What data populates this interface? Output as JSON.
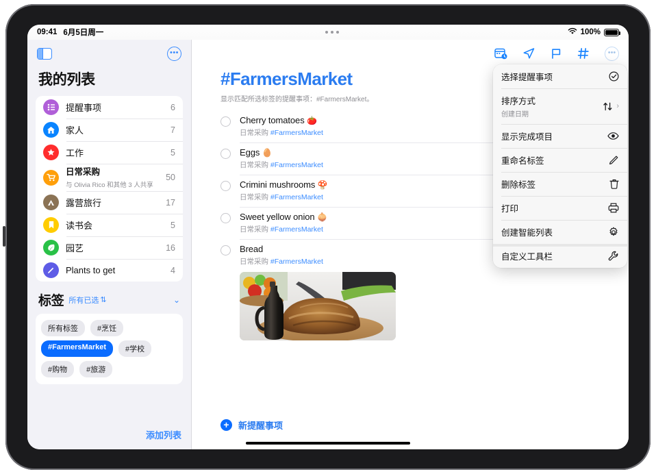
{
  "status_bar": {
    "time": "09:41",
    "date": "6月5日周一",
    "wifi_icon": "wifi-icon",
    "battery_percent": "100%",
    "battery_icon": "battery-full-icon"
  },
  "multitask_indicator": "multitasking-dots",
  "sidebar": {
    "toggle_icon": "sidebar-toggle-icon",
    "more_icon": "ellipsis-circle-icon",
    "title": "我的列表",
    "lists": [
      {
        "name": "提醒事项",
        "count": "6",
        "icon": "list-bullet-icon",
        "color": "#b05fd8",
        "subtitle": ""
      },
      {
        "name": "家人",
        "count": "7",
        "icon": "house-icon",
        "color": "#0a84ff",
        "subtitle": ""
      },
      {
        "name": "工作",
        "count": "5",
        "icon": "star-icon",
        "color": "#ff2d2d",
        "subtitle": ""
      },
      {
        "name": "日常采购",
        "count": "50",
        "icon": "shopping-cart-icon",
        "color": "#ff9f0a",
        "subtitle": "与 Olivia Rico 和其他 3 人共享"
      },
      {
        "name": "露营旅行",
        "count": "17",
        "icon": "tent-icon",
        "color": "#8b7355",
        "subtitle": ""
      },
      {
        "name": "读书会",
        "count": "5",
        "icon": "bookmark-icon",
        "color": "#ffcc00",
        "subtitle": ""
      },
      {
        "name": "园艺",
        "count": "16",
        "icon": "leaf-icon",
        "color": "#29c147",
        "subtitle": ""
      },
      {
        "name": "Plants to get",
        "count": "4",
        "icon": "pencil-icon",
        "color": "#5e5ce6",
        "subtitle": ""
      }
    ],
    "tags_section": {
      "title": "标签",
      "filter_label": "所有已选",
      "filter_icon": "up-down-chevron-icon",
      "collapse_icon": "chevron-down-icon",
      "tags": [
        {
          "label": "所有标签",
          "selected": false
        },
        {
          "label": "#烹饪",
          "selected": false
        },
        {
          "label": "#FarmersMarket",
          "selected": true
        },
        {
          "label": "#学校",
          "selected": false
        },
        {
          "label": "#购物",
          "selected": false
        },
        {
          "label": "#旅游",
          "selected": false
        }
      ]
    },
    "add_list_label": "添加列表"
  },
  "main": {
    "toolbar_icons": [
      "calendar-clock-icon",
      "location-arrow-icon",
      "flag-icon",
      "hashtag-icon"
    ],
    "more_icon": "ellipsis-circle-icon",
    "title": "#FarmersMarket",
    "subtitle": "显示匹配所选标签的提醒事项：#FarmersMarket。",
    "accent_color": "#2b7cf0",
    "reminders": [
      {
        "title": "Cherry tomatoes",
        "emoji": "🍅",
        "list": "日常采购",
        "tag": "#FarmersMarket",
        "completed": false,
        "has_photo": false
      },
      {
        "title": "Eggs",
        "emoji": "🥚",
        "list": "日常采购",
        "tag": "#FarmersMarket",
        "completed": false,
        "has_photo": false
      },
      {
        "title": "Crimini mushrooms",
        "emoji": "🍄",
        "list": "日常采购",
        "tag": "#FarmersMarket",
        "completed": false,
        "has_photo": false
      },
      {
        "title": "Sweet yellow onion",
        "emoji": "🧅",
        "list": "日常采购",
        "tag": "#FarmersMarket",
        "completed": false,
        "has_photo": false
      },
      {
        "title": "Bread",
        "emoji": "",
        "list": "日常采购",
        "tag": "#FarmersMarket",
        "completed": false,
        "has_photo": true
      }
    ],
    "photo_description": "bread-loaf-photo",
    "new_reminder": {
      "icon": "plus-circle-icon",
      "label": "新提醒事项"
    }
  },
  "context_menu": {
    "items": [
      {
        "label": "选择提醒事项",
        "sub": "",
        "icon": "checkmark-circle-icon",
        "chevron": false,
        "group_start": false
      },
      {
        "label": "排序方式",
        "sub": "创建日期",
        "icon": "sort-arrows-icon",
        "chevron": true,
        "group_start": false
      },
      {
        "label": "显示完成项目",
        "sub": "",
        "icon": "eye-icon",
        "chevron": false,
        "group_start": false
      },
      {
        "label": "重命名标签",
        "sub": "",
        "icon": "pencil-icon",
        "chevron": false,
        "group_start": false
      },
      {
        "label": "删除标签",
        "sub": "",
        "icon": "trash-icon",
        "chevron": false,
        "group_start": false
      },
      {
        "label": "打印",
        "sub": "",
        "icon": "printer-icon",
        "chevron": false,
        "group_start": false
      },
      {
        "label": "创建智能列表",
        "sub": "",
        "icon": "gear-icon",
        "chevron": false,
        "group_start": false
      },
      {
        "label": "自定义工具栏",
        "sub": "",
        "icon": "wrench-icon",
        "chevron": false,
        "group_start": true
      }
    ]
  }
}
